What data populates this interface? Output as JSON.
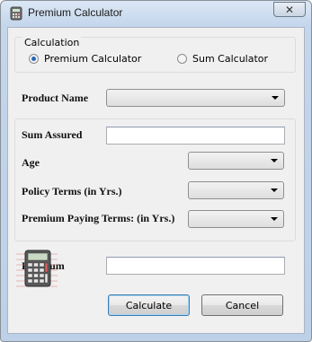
{
  "window": {
    "title": "Premium Calculator",
    "close_glyph": "✕"
  },
  "calculation": {
    "group_label": "Calculation",
    "options": [
      {
        "label": "Premium Calculator",
        "checked": true
      },
      {
        "label": "Sum Calculator",
        "checked": false
      }
    ]
  },
  "form": {
    "product_name_label": "Product Name",
    "product_name_value": "",
    "sum_assured_label": "Sum Assured",
    "sum_assured_value": "",
    "age_label": "Age",
    "age_value": "",
    "policy_terms_label": "Policy Terms (in Yrs.)",
    "policy_terms_value": "",
    "premium_paying_terms_label": "Premium Paying Terms: (in Yrs.)",
    "premium_paying_terms_value": "",
    "premium_label": "Premium",
    "premium_value": ""
  },
  "buttons": {
    "calculate": "Calculate",
    "cancel": "Cancel"
  },
  "icons": {
    "app": "calculator-icon",
    "close": "close-icon",
    "logo": "calculator-icon"
  },
  "colors": {
    "accent": "#2b66b8",
    "titlebar": "#c4d6ec"
  }
}
